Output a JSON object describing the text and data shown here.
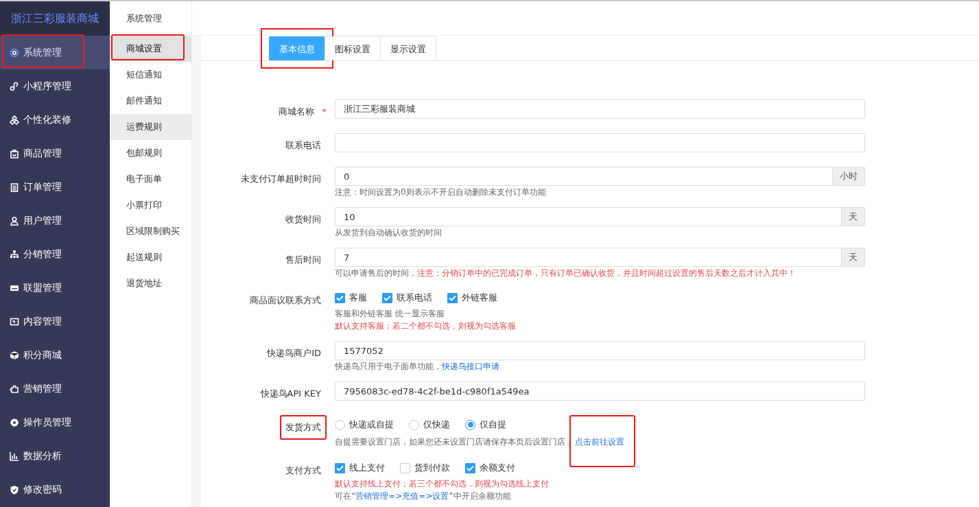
{
  "brand": "浙江三彩服装商城",
  "sidebar": {
    "items": [
      {
        "label": "系统管理",
        "selected": true,
        "highlighted": true
      },
      {
        "label": "小程序管理",
        "selected": false,
        "highlighted": false
      },
      {
        "label": "个性化装修",
        "selected": false,
        "highlighted": false
      },
      {
        "label": "商品管理",
        "selected": false,
        "highlighted": false
      },
      {
        "label": "订单管理",
        "selected": false,
        "highlighted": false
      },
      {
        "label": "用户管理",
        "selected": false,
        "highlighted": false
      },
      {
        "label": "分销管理",
        "selected": false,
        "highlighted": false
      },
      {
        "label": "联盟管理",
        "selected": false,
        "highlighted": false
      },
      {
        "label": "内容管理",
        "selected": false,
        "highlighted": false
      },
      {
        "label": "积分商城",
        "selected": false,
        "highlighted": false
      },
      {
        "label": "营销管理",
        "selected": false,
        "highlighted": false
      },
      {
        "label": "操作员管理",
        "selected": false,
        "highlighted": false
      },
      {
        "label": "数据分析",
        "selected": false,
        "highlighted": false
      },
      {
        "label": "修改密码",
        "selected": false,
        "highlighted": false
      }
    ]
  },
  "submenu": {
    "title": "系统管理",
    "items": [
      {
        "label": "商城设置",
        "selected": true,
        "hovered": false,
        "highlighted": true
      },
      {
        "label": "短信通知",
        "selected": false,
        "hovered": false,
        "highlighted": false
      },
      {
        "label": "邮件通知",
        "selected": false,
        "hovered": false,
        "highlighted": false
      },
      {
        "label": "运费规则",
        "selected": false,
        "hovered": true,
        "highlighted": false
      },
      {
        "label": "包邮规则",
        "selected": false,
        "hovered": false,
        "highlighted": false
      },
      {
        "label": "电子面单",
        "selected": false,
        "hovered": false,
        "highlighted": false
      },
      {
        "label": "小票打印",
        "selected": false,
        "hovered": false,
        "highlighted": false
      },
      {
        "label": "区域限制购买",
        "selected": false,
        "hovered": false,
        "highlighted": false
      },
      {
        "label": "起送规则",
        "selected": false,
        "hovered": false,
        "highlighted": false
      },
      {
        "label": "退货地址",
        "selected": false,
        "hovered": false,
        "highlighted": false
      }
    ]
  },
  "tabs": [
    {
      "label": "基本信息",
      "selected": true,
      "highlighted": true
    },
    {
      "label": "图标设置",
      "selected": false,
      "highlighted": false
    },
    {
      "label": "显示设置",
      "selected": false,
      "highlighted": false
    }
  ],
  "form": {
    "rows": [
      {
        "kind": "text",
        "label": "商城名称",
        "required_mark": "*",
        "highlighted": false,
        "value": "浙江三彩服装商城"
      },
      {
        "kind": "text",
        "label": "联系电话",
        "highlighted": false
      },
      {
        "kind": "addon",
        "label": "未支付订单超时时间",
        "highlighted": false,
        "value": "0",
        "addon": "小时",
        "notes": [
          {
            "segments": [
              {
                "text": "注意：时间设置为0则表示不开启自动删除未支付订单功能",
                "kind": "muted"
              }
            ]
          }
        ]
      },
      {
        "kind": "addon",
        "label": "收货时间",
        "highlighted": false,
        "value": "10",
        "addon": "天",
        "notes": [
          {
            "segments": [
              {
                "text": "从发货到自动确认收货的时间",
                "kind": "muted"
              }
            ]
          }
        ]
      },
      {
        "kind": "addon",
        "label": "售后时间",
        "highlighted": false,
        "value": "7",
        "addon": "天",
        "notes": [
          {
            "segments": [
              {
                "text": "可以申请售后的时间，",
                "kind": "muted"
              },
              {
                "text": "注意：分销订单中的已完成订单，只有订单已确认收货，并且时间超过设置的售后天数之后才计入其中！",
                "kind": "danger"
              }
            ]
          }
        ]
      },
      {
        "kind": "checkboxes",
        "label": "商品面议联系方式",
        "highlighted": false,
        "options": [
          {
            "label": "客服",
            "checked": true
          },
          {
            "label": "联系电话",
            "checked": true
          },
          {
            "label": "外链客服",
            "checked": true
          }
        ],
        "notes": [
          {
            "segments": [
              {
                "text": "客服和外链客服 统一显示客服",
                "kind": "muted"
              }
            ]
          },
          {
            "segments": [
              {
                "text": "默认支持客服；若二个都不勾选，则视为勾选客服",
                "kind": "danger"
              }
            ]
          }
        ]
      },
      {
        "kind": "text",
        "label": "快递鸟商户ID",
        "highlighted": false,
        "value": "1577052",
        "notes": [
          {
            "segments": [
              {
                "text": "快递鸟只用于电子面单功能，",
                "kind": "muted"
              },
              {
                "text": "快递鸟接口申请",
                "kind": "link",
                "highlighted": false
              }
            ]
          }
        ]
      },
      {
        "kind": "text",
        "label": "快递鸟API KEY",
        "highlighted": false,
        "value": "7956083c-ed78-4c2f-be1d-c980f1a549ea"
      },
      {
        "kind": "radios",
        "label": "发货方式",
        "highlighted": true,
        "options": [
          {
            "label": "快递或自提",
            "selected": false
          },
          {
            "label": "仅快递",
            "selected": false
          },
          {
            "label": "仅自提",
            "selected": true
          }
        ],
        "notes": [
          {
            "segments": [
              {
                "text": "自提需要设置门店，如果您还未设置门店请保存本页后设置门店，",
                "kind": "muted"
              },
              {
                "text": "点击前往设置",
                "kind": "link",
                "highlighted": true
              }
            ]
          }
        ]
      },
      {
        "kind": "checkboxes",
        "label": "支付方式",
        "highlighted": false,
        "options": [
          {
            "label": "线上支付",
            "checked": true
          },
          {
            "label": "货到付款",
            "checked": false
          },
          {
            "label": "余额支付",
            "checked": true
          }
        ],
        "notes": [
          {
            "segments": [
              {
                "text": "默认支持线上支付；若三个都不勾选，则视为勾选线上支付",
                "kind": "danger"
              }
            ]
          },
          {
            "segments": [
              {
                "text": "可在“",
                "kind": "muted"
              },
              {
                "text": "营销管理=>充值=>设置",
                "kind": "accent"
              },
              {
                "text": "”中开启余额功能",
                "kind": "muted"
              }
            ]
          }
        ]
      }
    ]
  }
}
